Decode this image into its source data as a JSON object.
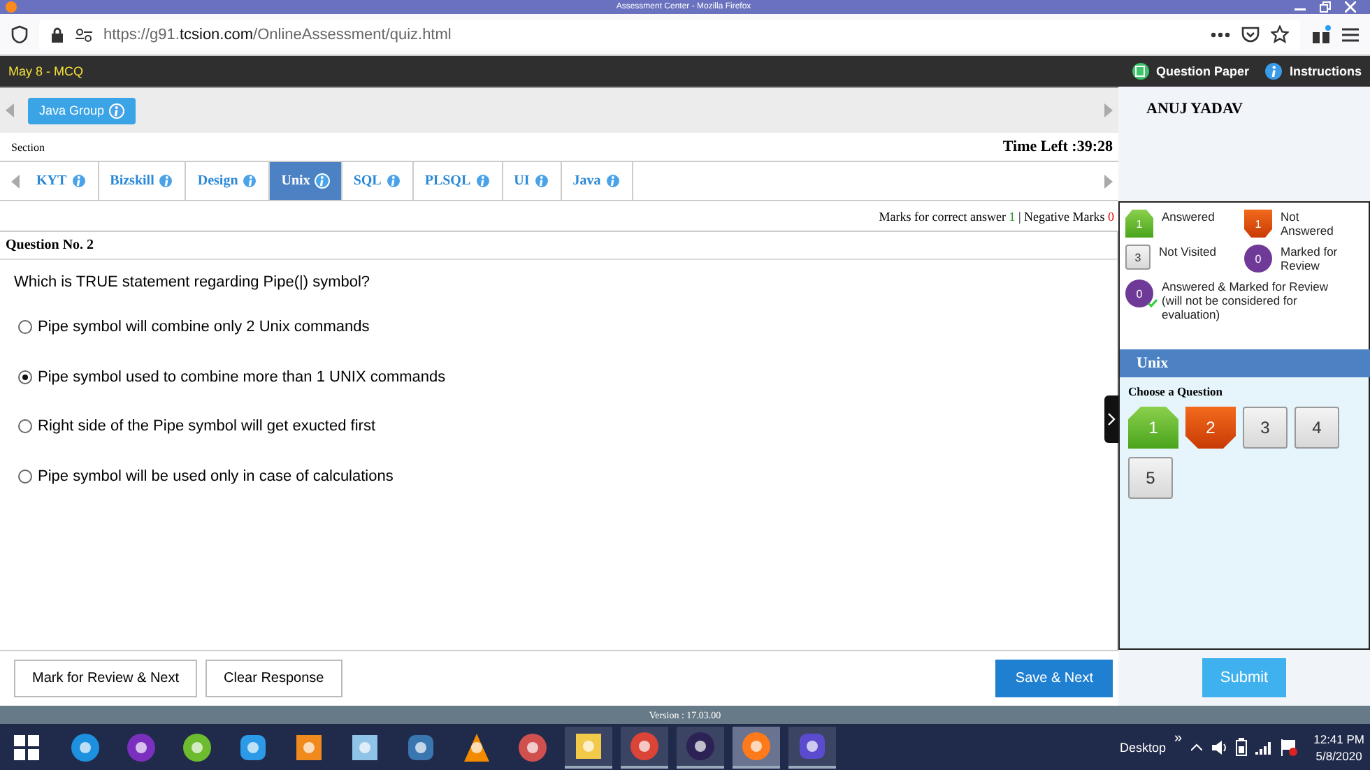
{
  "window": {
    "title": "Assessment Center - Mozilla Firefox"
  },
  "browser": {
    "url": {
      "prefix": "https://g91.",
      "domain": "tcsion.com",
      "path": "/OnlineAssessment/quiz.html"
    }
  },
  "app_bar": {
    "title": "May 8 - MCQ",
    "links": [
      "Question Paper",
      "Instructions"
    ]
  },
  "groups": [
    {
      "label": "Java Group",
      "selected": true
    }
  ],
  "section_label": "Section",
  "time_left": "Time Left :39:28",
  "sections": [
    {
      "label": "KYT",
      "selected": false
    },
    {
      "label": "Bizskill",
      "selected": false
    },
    {
      "label": "Design",
      "selected": false
    },
    {
      "label": "Unix",
      "selected": true
    },
    {
      "label": "SQL",
      "selected": false
    },
    {
      "label": "PLSQL",
      "selected": false
    },
    {
      "label": "UI",
      "selected": false
    },
    {
      "label": "Java",
      "selected": false
    }
  ],
  "marks": {
    "correct_label": "Marks for correct answer",
    "correct": "1",
    "negative_label": "| Negative Marks",
    "negative": "0"
  },
  "question": {
    "number": "Question No. 2",
    "text": "Which is TRUE statement regarding Pipe(|) symbol?",
    "options": [
      {
        "text": "Pipe symbol will combine only 2 Unix commands",
        "selected": false
      },
      {
        "text": "Pipe symbol used to combine more than 1 UNIX commands",
        "selected": true
      },
      {
        "text": "Right side of the Pipe symbol will get exucted first",
        "selected": false
      },
      {
        "text": "Pipe symbol will be used only in case of calculations",
        "selected": false
      }
    ]
  },
  "actions": [
    "Mark for Review & Next",
    "Clear Response"
  ],
  "save_button": "Save & Next",
  "candidate": "ANUJ YADAV",
  "legend": [
    {
      "kind": "answered",
      "count": "1",
      "label": "Answered"
    },
    {
      "kind": "not_answered",
      "count": "1",
      "label": "Not Answered"
    },
    {
      "kind": "not_visited",
      "count": "3",
      "label": "Not Visited"
    },
    {
      "kind": "marked",
      "count": "0",
      "label": "Marked for Review"
    },
    {
      "kind": "answered_marked",
      "count": "0",
      "label": "Answered & Marked for Review (will not be considered for evaluation)"
    }
  ],
  "palette": {
    "section": "Unix",
    "heading": "Choose a Question",
    "questions": [
      {
        "number": "1",
        "kind": "answered"
      },
      {
        "number": "2",
        "kind": "not_answered"
      },
      {
        "number": "3",
        "kind": "not_visited"
      },
      {
        "number": "4",
        "kind": "not_visited"
      },
      {
        "number": "5",
        "kind": "not_visited"
      }
    ]
  },
  "submit_button": "Submit",
  "version": "Version : 17.03.00",
  "taskbar": {
    "apps": [
      {
        "running": false,
        "selected": false
      },
      {
        "running": false,
        "selected": false
      },
      {
        "running": false,
        "selected": false
      },
      {
        "running": false,
        "selected": false
      },
      {
        "running": false,
        "selected": false
      },
      {
        "running": false,
        "selected": false
      },
      {
        "running": false,
        "selected": false
      },
      {
        "running": false,
        "selected": false
      },
      {
        "running": false,
        "selected": false
      },
      {
        "running": true,
        "selected": false
      },
      {
        "running": true,
        "selected": false
      },
      {
        "running": true,
        "selected": false
      },
      {
        "running": true,
        "selected": true
      },
      {
        "running": true,
        "selected": false
      }
    ],
    "desktop": "Desktop",
    "more": "»",
    "time": "12:41 PM",
    "date": "5/8/2020"
  }
}
